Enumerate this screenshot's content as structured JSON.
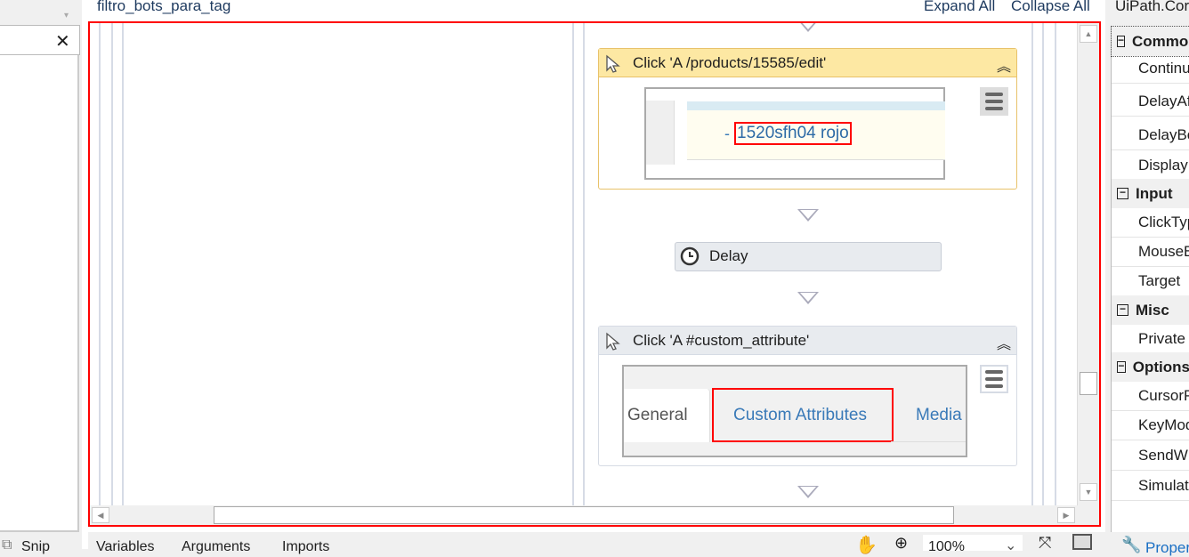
{
  "left_panel": {
    "close_icon": "✕",
    "snip_label": "Snip"
  },
  "designer": {
    "title": "filtro_bots_para_tag",
    "expand_all": "Expand All",
    "collapse_all": "Collapse All",
    "activities": [
      {
        "title": "Click 'A  /products/15585/edit'",
        "preview_prefix": "-",
        "preview_text": "1520sfh04  rojo"
      },
      {
        "title": "Delay"
      },
      {
        "title": "Click 'A  #custom_attribute'",
        "tabs": [
          "General",
          "Custom Attributes",
          "Media"
        ]
      }
    ]
  },
  "bottom_tabs": [
    "Variables",
    "Arguments",
    "Imports"
  ],
  "zoom_level": "100%",
  "properties": {
    "title": "UiPath.Cor",
    "rows": [
      {
        "type": "cat",
        "label": "Common",
        "state": "−"
      },
      {
        "type": "item",
        "label": "Continu"
      },
      {
        "type": "item",
        "label": "DelayAf"
      },
      {
        "type": "item",
        "label": "DelayBe"
      },
      {
        "type": "item",
        "label": "Display"
      },
      {
        "type": "cat",
        "label": "Input",
        "state": "−"
      },
      {
        "type": "item",
        "label": "ClickTyp"
      },
      {
        "type": "item",
        "label": "MouseB"
      },
      {
        "type": "item",
        "label": "Target",
        "state": "+"
      },
      {
        "type": "cat",
        "label": "Misc",
        "state": "−"
      },
      {
        "type": "item",
        "label": "Private"
      },
      {
        "type": "cat",
        "label": "Options",
        "state": "−"
      },
      {
        "type": "item",
        "label": "CursorP",
        "state": "+"
      },
      {
        "type": "item",
        "label": "KeyMod"
      },
      {
        "type": "item",
        "label": "SendW"
      },
      {
        "type": "item",
        "label": "Simulat"
      }
    ],
    "footer_label": "Propert"
  }
}
